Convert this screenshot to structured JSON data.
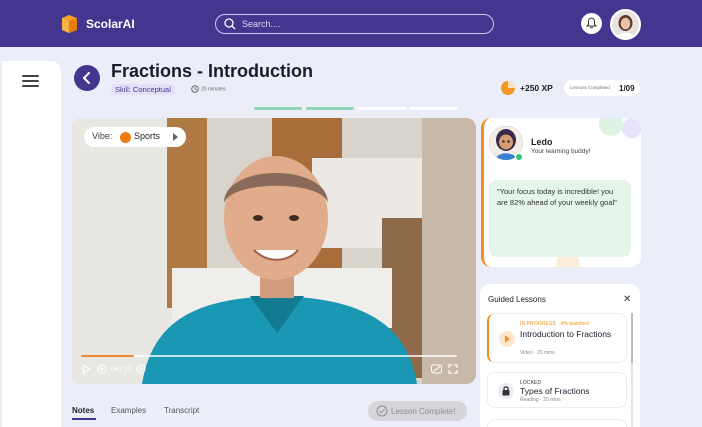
{
  "app": {
    "name": "ScolarAI"
  },
  "search": {
    "placeholder": "Search...."
  },
  "lesson": {
    "title": "Fractions - Introduction",
    "skill": "Skill: Conceptual",
    "duration": "20 minutes"
  },
  "stats": {
    "xp": "+250 XP",
    "lessons_completed_label": "Lessons Completed",
    "lessons_completed": "1/09"
  },
  "progress": {
    "segments_filled": 2,
    "segments_total": 4
  },
  "video": {
    "vibe_label": "Vibe:",
    "vibe_value": "Sports",
    "time": "04 / 20",
    "progress": 0.14
  },
  "tabs": [
    {
      "label": "Notes",
      "active": true
    },
    {
      "label": "Examples",
      "active": false
    },
    {
      "label": "Transcript",
      "active": false
    }
  ],
  "complete_button": {
    "label": "Lesson Complete!"
  },
  "buddy": {
    "name": "Ledo",
    "subtitle": "Your learning buddy!",
    "message": "\"Your focus today is incredible! you are 82% ahead of your weekly goal\""
  },
  "guided_lessons": {
    "title": "Guided Lessons",
    "close": "✕",
    "items": [
      {
        "status": "IN PROGRESS",
        "watched": "4% watched",
        "name": "Introduction to Fractions",
        "type": "Video",
        "duration": "20 mins"
      },
      {
        "status": "LOCKED",
        "name": "Types of Fractions",
        "type": "Reading",
        "duration": "20 mins"
      }
    ]
  },
  "colors": {
    "brand": "#44368f",
    "accent": "#f0901f",
    "success": "#36c47a"
  },
  "icons": [
    "logo-icon",
    "search-icon",
    "bell-icon",
    "menu-icon",
    "back-arrow-icon",
    "clock-icon",
    "xp-icon",
    "play-icon",
    "replay-icon",
    "forward-icon",
    "captions-icon",
    "fullscreen-icon",
    "check-circle-icon",
    "close-icon",
    "play-circle-icon",
    "lock-icon"
  ]
}
